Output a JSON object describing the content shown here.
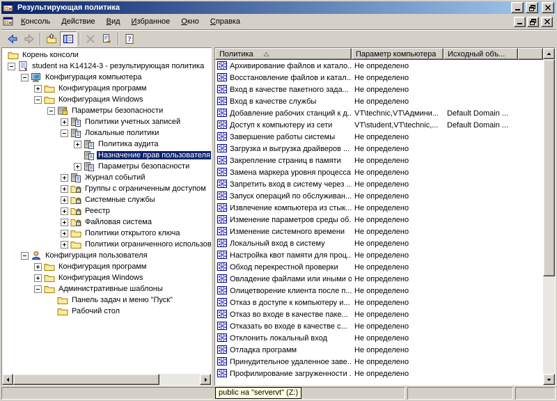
{
  "window": {
    "title": "Результирующая политика"
  },
  "menubar": {
    "items": [
      {
        "key": "console",
        "label": "Консоль"
      },
      {
        "key": "action",
        "label": "Действие"
      },
      {
        "key": "view",
        "label": "Вид"
      },
      {
        "key": "favorites",
        "label": "Избранное"
      },
      {
        "key": "window",
        "label": "Окно"
      },
      {
        "key": "help",
        "label": "Справка"
      }
    ]
  },
  "toolbar": {
    "buttons": [
      {
        "type": "button",
        "icon": "back",
        "name": "back-button",
        "enabled": true
      },
      {
        "type": "button",
        "icon": "forward",
        "name": "forward-button",
        "enabled": false
      },
      {
        "type": "separator"
      },
      {
        "type": "button",
        "icon": "up",
        "name": "up-one-level-button",
        "enabled": true
      },
      {
        "type": "button",
        "icon": "tree-toggle",
        "name": "show-hide-tree-button",
        "enabled": true,
        "pressed": true
      },
      {
        "type": "separator"
      },
      {
        "type": "button",
        "icon": "delete",
        "name": "delete-button",
        "enabled": false
      },
      {
        "type": "button",
        "icon": "export-list",
        "name": "export-list-button",
        "enabled": true
      },
      {
        "type": "separator"
      },
      {
        "type": "button",
        "icon": "help",
        "name": "help-button",
        "enabled": true
      }
    ]
  },
  "tree": {
    "items": [
      {
        "label": "Корень консоли",
        "level": 0,
        "expand": "root",
        "icon": "folder"
      },
      {
        "label": "student на K14124-3 - результирующая политика",
        "level": 1,
        "expand": "minus",
        "icon": "rsop"
      },
      {
        "label": "Конфигурация компьютера",
        "level": 2,
        "expand": "minus",
        "icon": "computer"
      },
      {
        "label": "Конфигурация программ",
        "level": 3,
        "expand": "plus",
        "icon": "folder"
      },
      {
        "label": "Конфигурация Windows",
        "level": 3,
        "expand": "minus",
        "icon": "folder"
      },
      {
        "label": "Параметры безопасности",
        "level": 4,
        "expand": "minus",
        "icon": "security"
      },
      {
        "label": "Политики учетных записей",
        "level": 5,
        "expand": "plus",
        "icon": "policy"
      },
      {
        "label": "Локальные политики",
        "level": 5,
        "expand": "minus",
        "icon": "policy"
      },
      {
        "label": "Политика аудита",
        "level": 6,
        "expand": "plus",
        "icon": "policy"
      },
      {
        "label": "Назначение прав пользователя",
        "level": 6,
        "expand": "leaf",
        "icon": "policy",
        "selected": true
      },
      {
        "label": "Параметры безопасности",
        "level": 6,
        "expand": "plus",
        "icon": "policy"
      },
      {
        "label": "Журнал событий",
        "level": 5,
        "expand": "plus",
        "icon": "policy"
      },
      {
        "label": "Группы с ограниченным доступом",
        "level": 5,
        "expand": "plus",
        "icon": "lockfolder"
      },
      {
        "label": "Системные службы",
        "level": 5,
        "expand": "plus",
        "icon": "lockfolder"
      },
      {
        "label": "Реестр",
        "level": 5,
        "expand": "plus",
        "icon": "lockfolder"
      },
      {
        "label": "Файловая система",
        "level": 5,
        "expand": "plus",
        "icon": "lockfolder"
      },
      {
        "label": "Политики открытого ключа",
        "level": 5,
        "expand": "plus",
        "icon": "folder"
      },
      {
        "label": "Политики ограниченного использов",
        "level": 5,
        "expand": "plus",
        "icon": "folder"
      },
      {
        "label": "Конфигурация пользователя",
        "level": 2,
        "expand": "minus",
        "icon": "user"
      },
      {
        "label": "Конфигурация программ",
        "level": 3,
        "expand": "plus",
        "icon": "folder"
      },
      {
        "label": "Конфигурация Windows",
        "level": 3,
        "expand": "plus",
        "icon": "folder"
      },
      {
        "label": "Административные шаблоны",
        "level": 3,
        "expand": "minus",
        "icon": "folder"
      },
      {
        "label": "Панель задач и меню \"Пуск\"",
        "level": 4,
        "expand": "leaf",
        "icon": "folder"
      },
      {
        "label": "Рабочий стол",
        "level": 4,
        "expand": "leaf",
        "icon": "folder"
      }
    ]
  },
  "list": {
    "columns": [
      "Политика",
      "Параметр компьютера",
      "Исходный объ..."
    ],
    "rows": [
      {
        "policy": "Архивирование файлов и катало...",
        "setting": "Не определено",
        "source": ""
      },
      {
        "policy": "Восстановление файлов и катал...",
        "setting": "Не определено",
        "source": ""
      },
      {
        "policy": "Вход в качестве пакетного зада...",
        "setting": "Не определено",
        "source": ""
      },
      {
        "policy": "Вход в качестве службы",
        "setting": "Не определено",
        "source": ""
      },
      {
        "policy": "Добавление рабочих станций к д...",
        "setting": "VT\\technic,VT\\Админи...",
        "source": "Default Domain ..."
      },
      {
        "policy": "Доступ к компьютеру из сети",
        "setting": "VT\\student,VT\\technic,...",
        "source": "Default Domain ..."
      },
      {
        "policy": "Завершение работы системы",
        "setting": "Не определено",
        "source": ""
      },
      {
        "policy": "Загрузка и выгрузка драйверов ...",
        "setting": "Не определено",
        "source": ""
      },
      {
        "policy": "Закрепление страниц в памяти",
        "setting": "Не определено",
        "source": ""
      },
      {
        "policy": "Замена маркера уровня процесса",
        "setting": "Не определено",
        "source": ""
      },
      {
        "policy": "Запретить вход в систему через ...",
        "setting": "Не определено",
        "source": ""
      },
      {
        "policy": "Запуск операций по обслуживан...",
        "setting": "Не определено",
        "source": ""
      },
      {
        "policy": "Извлечение компьютера из стык...",
        "setting": "Не определено",
        "source": ""
      },
      {
        "policy": "Изменение параметров среды об...",
        "setting": "Не определено",
        "source": ""
      },
      {
        "policy": "Изменение системного времени",
        "setting": "Не определено",
        "source": ""
      },
      {
        "policy": "Локальный вход в систему",
        "setting": "Не определено",
        "source": ""
      },
      {
        "policy": "Настройка квот памяти для проц...",
        "setting": "Не определено",
        "source": ""
      },
      {
        "policy": "Обход перекрестной проверки",
        "setting": "Не определено",
        "source": ""
      },
      {
        "policy": "Овладение файлами или иными о...",
        "setting": "Не определено",
        "source": ""
      },
      {
        "policy": "Олицетворение клиента после п...",
        "setting": "Не определено",
        "source": ""
      },
      {
        "policy": "Отказ в доступе к компьютеру и...",
        "setting": "Не определено",
        "source": ""
      },
      {
        "policy": "Отказ во входе в качестве паке...",
        "setting": "Не определено",
        "source": ""
      },
      {
        "policy": "Отказать во входе в качестве с...",
        "setting": "Не определено",
        "source": ""
      },
      {
        "policy": "Отклонить локальный вход",
        "setting": "Не определено",
        "source": ""
      },
      {
        "policy": "Отладка программ",
        "setting": "Не определено",
        "source": ""
      },
      {
        "policy": "Принудительное удаленное заве...",
        "setting": "Не определено",
        "source": ""
      },
      {
        "policy": "Профилирование загруженности ...",
        "setting": "Не определено",
        "source": ""
      }
    ]
  },
  "statusbar": {
    "tooltip": "public на \"servervt\" (Z:)"
  },
  "colors": {
    "titlebar_left": "#0a246a",
    "titlebar_right": "#a6caf0",
    "selection": "#0a246a",
    "chrome": "#d4d0c8",
    "tooltip_bg": "#ffffe1",
    "panel_bg": "#ffffff"
  }
}
